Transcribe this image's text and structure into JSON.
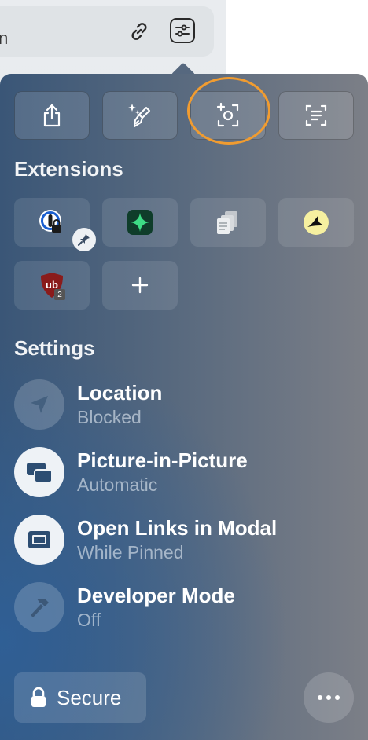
{
  "background": {
    "partial_text": "n"
  },
  "toolbar_icons": {
    "link": "link-icon",
    "settings": "sliders-icon"
  },
  "actions": [
    {
      "name": "share",
      "icon": "share-icon"
    },
    {
      "name": "magic-clean",
      "icon": "sparkle-brush-icon"
    },
    {
      "name": "capture",
      "icon": "screen-capture-icon"
    },
    {
      "name": "reader",
      "icon": "text-scan-icon"
    }
  ],
  "extensions": {
    "title": "Extensions",
    "items": [
      {
        "name": "password-manager",
        "icon": "keyhole-lock-icon",
        "pinned": true
      },
      {
        "name": "green-star-extension",
        "icon": "star-sparkle-icon"
      },
      {
        "name": "copy-extension",
        "icon": "documents-icon"
      },
      {
        "name": "yellow-bird-extension",
        "icon": "bird-icon"
      },
      {
        "name": "ublock",
        "icon": "shield-ub-icon",
        "badge": "2"
      },
      {
        "name": "add-extension",
        "icon": "plus-icon"
      }
    ]
  },
  "settings": {
    "title": "Settings",
    "items": [
      {
        "title": "Location",
        "value": "Blocked",
        "icon": "location-arrow-icon",
        "active": false
      },
      {
        "title": "Picture-in-Picture",
        "value": "Automatic",
        "icon": "pip-icon",
        "active": true
      },
      {
        "title": "Open Links in Modal",
        "value": "While Pinned",
        "icon": "modal-window-icon",
        "active": true
      },
      {
        "title": "Developer Mode",
        "value": "Off",
        "icon": "hammer-icon",
        "active": false
      }
    ]
  },
  "footer": {
    "secure_label": "Secure",
    "more_icon": "ellipsis-icon"
  },
  "colors": {
    "highlight": "#f19c30"
  }
}
